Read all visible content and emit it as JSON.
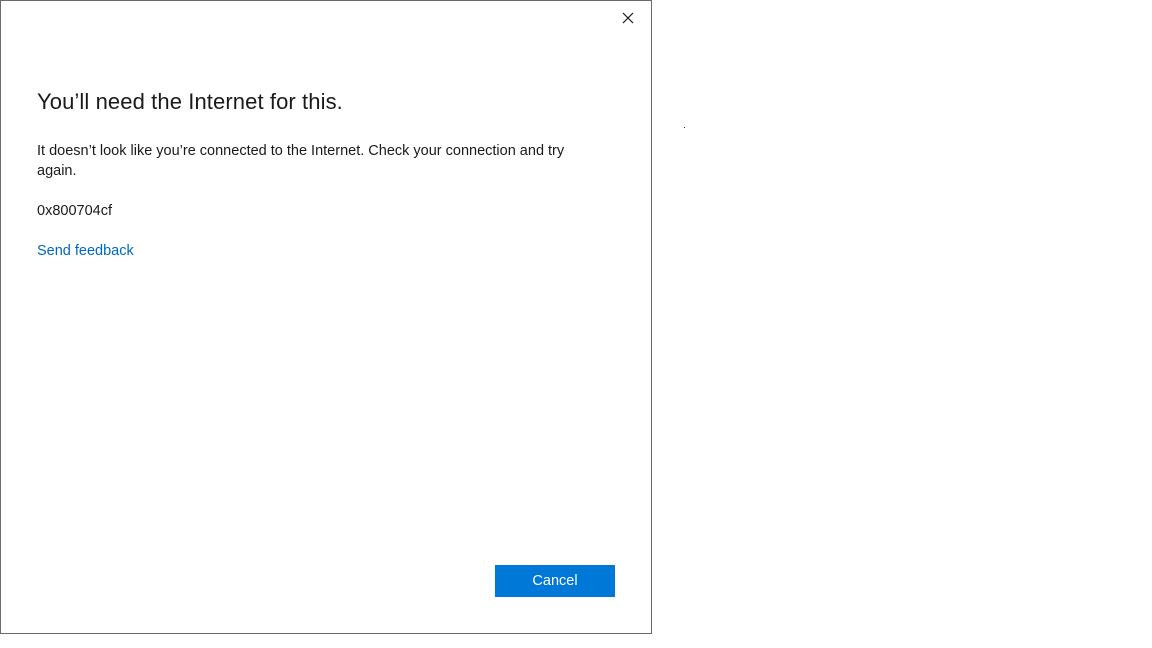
{
  "dialog": {
    "title": "You’ll need the Internet for this.",
    "message": "It doesn’t look like you’re connected to the Internet. Check your connection and try again.",
    "error_code": "0x800704cf",
    "feedback_link": "Send feedback",
    "cancel_label": "Cancel",
    "close_icon": "close-icon"
  },
  "colors": {
    "accent": "#0078d7",
    "link": "#0067c0",
    "text": "#1a1a1a",
    "border": "#6b6b6b"
  }
}
